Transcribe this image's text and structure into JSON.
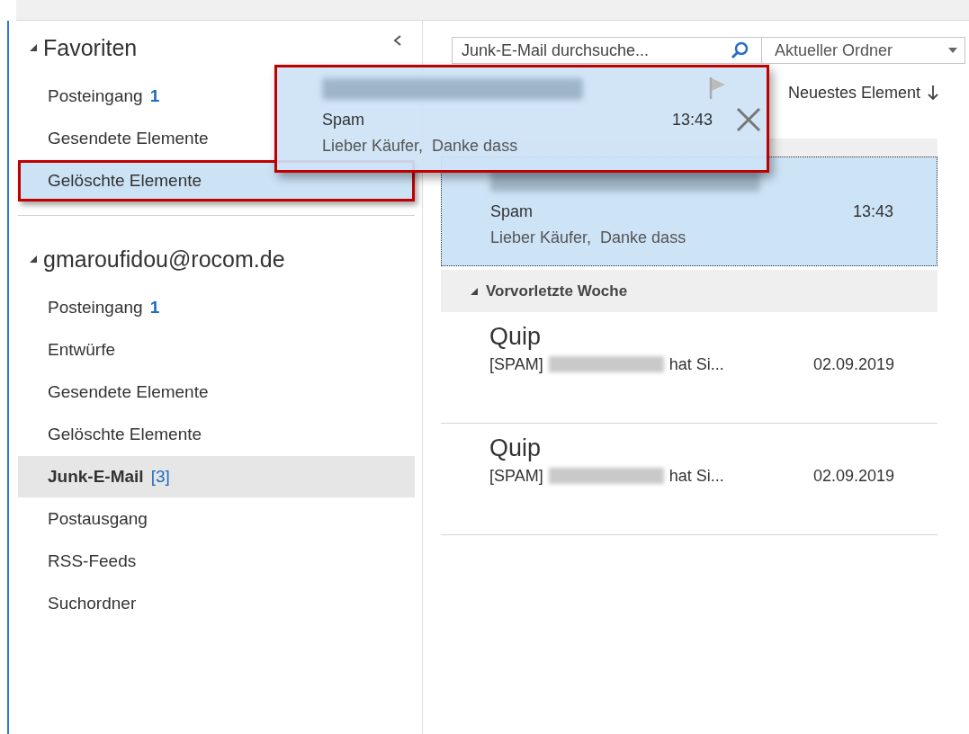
{
  "nav": {
    "sections": [
      {
        "title": "Favoriten",
        "expanded": true,
        "items": [
          {
            "label": "Posteingang",
            "count": "1",
            "count_bold": true,
            "selected": false,
            "drop_target": false,
            "annotated": false
          },
          {
            "label": "Gesendete Elemente",
            "selected": false,
            "drop_target": false,
            "annotated": false
          },
          {
            "label": "Gelöschte Elemente",
            "selected": false,
            "drop_target": true,
            "annotated": true
          }
        ]
      },
      {
        "title": "gmaroufidou@rocom.de",
        "expanded": true,
        "items": [
          {
            "label": "Posteingang",
            "count": "1",
            "count_bold": true,
            "selected": false,
            "drop_target": false,
            "annotated": false
          },
          {
            "label": "Entwürfe",
            "selected": false,
            "drop_target": false,
            "annotated": false
          },
          {
            "label": "Gesendete Elemente",
            "selected": false,
            "drop_target": false,
            "annotated": false
          },
          {
            "label": "Gelöschte Elemente",
            "selected": false,
            "drop_target": false,
            "annotated": false
          },
          {
            "label": "Junk-E-Mail",
            "count": "[3]",
            "count_bold": false,
            "selected": true,
            "drop_target": false,
            "annotated": false
          },
          {
            "label": "Postausgang",
            "selected": false,
            "drop_target": false,
            "annotated": false
          },
          {
            "label": "RSS-Feeds",
            "selected": false,
            "drop_target": false,
            "annotated": false
          },
          {
            "label": "Suchordner",
            "selected": false,
            "drop_target": false,
            "annotated": false
          }
        ]
      }
    ]
  },
  "mail_list": {
    "search": {
      "placeholder": "Junk-E-Mail durchsuche..."
    },
    "scope": "Aktueller Ordner",
    "sort": "Neuestes Element",
    "groups": [
      {
        "messages": [
          {
            "kind": "preview",
            "sender_redacted": true,
            "subject": "Spam",
            "time": "13:43",
            "preview": "Lieber Käufer,  Danke dass",
            "selected": true
          }
        ]
      },
      {
        "title": "Vorvorletzte Woche",
        "expanded": true,
        "messages": [
          {
            "kind": "compact",
            "sender": "Quip",
            "subject_prefix": "[SPAM]",
            "subject_suffix": "hat Si...",
            "time": "02.09.2019",
            "selected": false
          },
          {
            "kind": "compact",
            "sender": "Quip",
            "subject_prefix": "[SPAM]",
            "subject_suffix": "hat Si...",
            "time": "02.09.2019",
            "selected": false
          }
        ]
      }
    ]
  },
  "drag_item": {
    "subject": "Spam",
    "time": "13:43",
    "preview": "Lieber Käufer,  Danke dass",
    "annotated": true
  }
}
